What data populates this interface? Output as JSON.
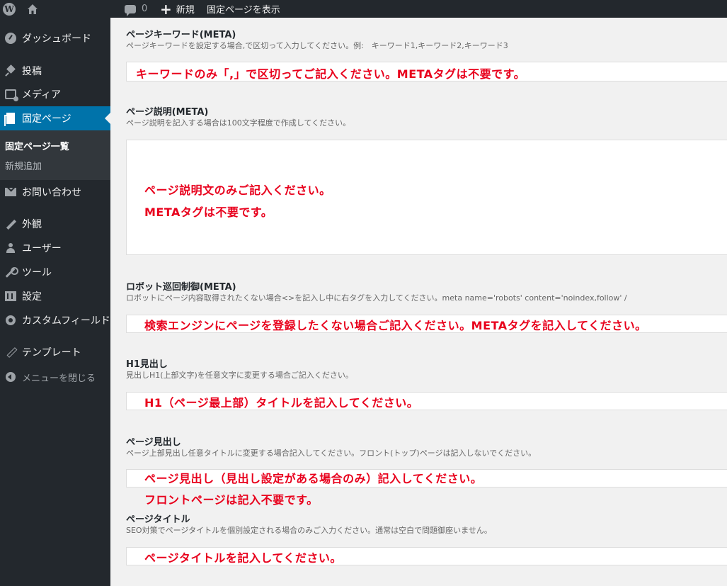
{
  "adminbar": {
    "logo_icon": "wordpress-icon",
    "home_icon": "home-icon",
    "comment_count": "0",
    "new_label": "新規",
    "view_page_label": "固定ページを表示"
  },
  "sidebar": {
    "items": [
      {
        "label": "ダッシュボード",
        "icon": "dashboard-icon"
      },
      {
        "label": "投稿",
        "icon": "pin-icon"
      },
      {
        "label": "メディア",
        "icon": "media-icon"
      },
      {
        "label": "固定ページ",
        "icon": "page-icon",
        "current": true
      },
      {
        "label": "お問い合わせ",
        "icon": "mail-icon"
      },
      {
        "label": "外観",
        "icon": "brush-icon"
      },
      {
        "label": "ユーザー",
        "icon": "user-icon"
      },
      {
        "label": "ツール",
        "icon": "wrench-icon"
      },
      {
        "label": "設定",
        "icon": "settings-icon"
      },
      {
        "label": "カスタムフィールド",
        "icon": "gear-icon"
      },
      {
        "label": "テンプレート",
        "icon": "pencil-icon"
      }
    ],
    "submenu": [
      "固定ページ一覧",
      "新規追加"
    ],
    "collapse_label": "メニューを閉じる"
  },
  "fields": {
    "keywords": {
      "label": "ページキーワード(META)",
      "desc": "ページキーワードを設定する場合,で区切って入力してください。例:　キーワード1,キーワード2,キーワード3",
      "note": "キーワードのみ「,」で区切ってご記入ください。METAタグは不要です。"
    },
    "description": {
      "label": "ページ説明(META)",
      "desc": "ページ説明を記入する場合は100文字程度で作成してください。",
      "note1": "ページ説明文のみご記入ください。",
      "note2": "METAタグは不要です。"
    },
    "robots": {
      "label": "ロボット巡回制御(META)",
      "desc": "ロボットにページ内容取得されたくない場合<>を記入し中に右タグを入力してください。meta name='robots' content='noindex,follow' /",
      "note": "検索エンジンにページを登録したくない場合ご記入ください。METAタグを記入してください。"
    },
    "h1": {
      "label": "H1見出し",
      "desc": "見出しH1(上部文字)を任意文字に変更する場合ご記入ください。",
      "note": "H1（ページ最上部）タイトルを記入してください。"
    },
    "heading": {
      "label": "ページ見出し",
      "desc": "ページ上部見出し任意タイトルに変更する場合記入してください。フロント(トップ)ページは記入しないでください。",
      "note1": "ページ見出し（見出し設定がある場合のみ）記入してください。",
      "note2": "フロントページは記入不要です。"
    },
    "title": {
      "label": "ページタイトル",
      "desc": "SEO対策でページタイトルを個別設定される場合のみご入力ください。通常は空白で問題御座いません。",
      "note": "ページタイトルを記入してください。"
    }
  }
}
